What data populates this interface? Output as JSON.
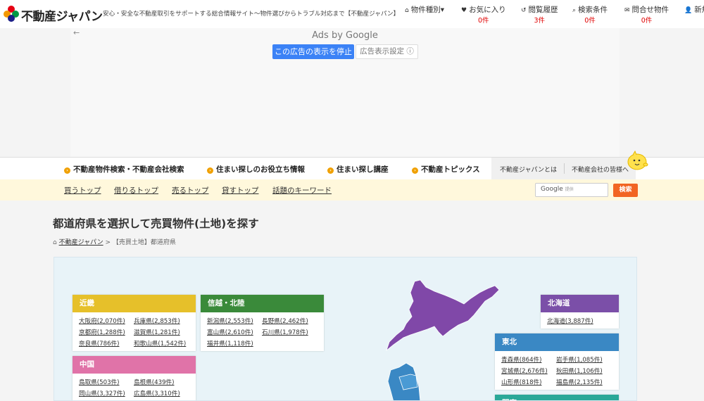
{
  "header": {
    "logo_text": "不動産ジャパン",
    "tagline": "安心・安全な不動産取引をサポートする総合情報サイト〜物件選びからトラブル対応まで【不動産ジャパン】",
    "nav": [
      {
        "label": "物件種別▾",
        "icon": "home-icon",
        "count": ""
      },
      {
        "label": "お気に入り",
        "icon": "heart-icon",
        "count": "0件"
      },
      {
        "label": "閲覧履歴",
        "icon": "history-icon",
        "count": "3件"
      },
      {
        "label": "検索条件",
        "icon": "search-icon",
        "count": "0件"
      },
      {
        "label": "問合せ物件",
        "icon": "mail-icon",
        "count": "0件"
      },
      {
        "label": "新規",
        "icon": "user-icon",
        "count": ""
      }
    ]
  },
  "ad": {
    "back": "←",
    "ads_by": "Ads by Google",
    "stop_label": "この広告の表示を停止",
    "settings_label": "広告表示設定 ⓘ"
  },
  "menu": {
    "items": [
      "不動産物件検索・不動産会社検索",
      "住まい探しのお役立ち情報",
      "住まい探し講座",
      "不動産トピックス"
    ],
    "about": "不動産ジャパンとは",
    "companies": "不動産会社の皆様へ"
  },
  "subnav": {
    "links": [
      "買うトップ",
      "借りるトップ",
      "売るトップ",
      "貸すトップ",
      "話題のキーワード"
    ],
    "search_brand": "Google",
    "search_powered": "提供",
    "search_button": "検索"
  },
  "page": {
    "title": "都道府県を選択して売買物件(土地)を探す",
    "breadcrumb_home": "不動産ジャパン",
    "breadcrumb_sep": ">",
    "breadcrumb_current": "【売買土地】都道府県"
  },
  "regions": {
    "kinki": {
      "name": "近畿",
      "color": "#e6c02a",
      "prefs": [
        "大阪府(2,070件)",
        "兵庫県(2,853件)",
        "京都府(1,288件)",
        "滋賀県(1,281件)",
        "奈良県(786件)",
        "和歌山県(1,542件)"
      ]
    },
    "shinetsu": {
      "name": "信越・北陸",
      "color": "#3a8a3a",
      "prefs": [
        "新潟県(2,553件)",
        "長野県(2,462件)",
        "富山県(2,610件)",
        "石川県(1,978件)",
        "福井県(1,118件)"
      ]
    },
    "chugoku": {
      "name": "中国",
      "color": "#e073a8",
      "prefs": [
        "鳥取県(503件)",
        "島根県(439件)",
        "岡山県(3,327件)",
        "広島県(3,310件)"
      ]
    },
    "hokkaido": {
      "name": "北海道",
      "color": "#7b4fa8",
      "prefs": [
        "北海道(3,887件)"
      ]
    },
    "tohoku": {
      "name": "東北",
      "color": "#3a88c4",
      "prefs": [
        "青森県(864件)",
        "岩手県(1,085件)",
        "宮城県(2,676件)",
        "秋田県(1,106件)",
        "山形県(818件)",
        "福島県(2,135件)"
      ]
    },
    "kanto": {
      "name": "関東",
      "color": "#2aa898",
      "prefs": []
    }
  },
  "colors": {
    "accent_orange": "#f26522",
    "count_red": "#e00000",
    "subnav_bg": "#fff8dc",
    "hokkaido": "#8048a8",
    "tohoku": "#3a88c4"
  }
}
